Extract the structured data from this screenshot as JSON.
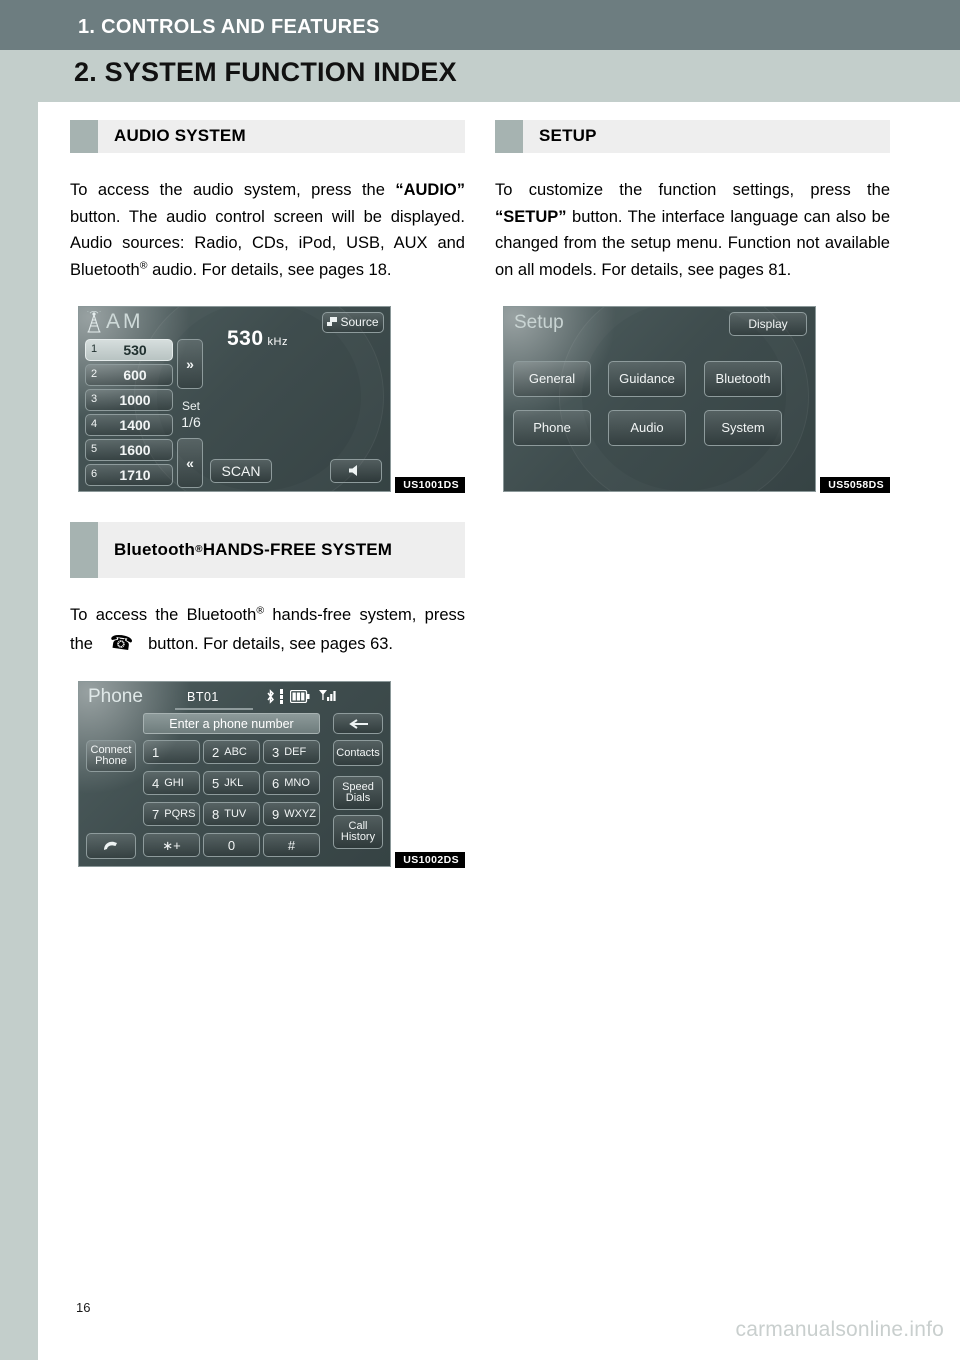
{
  "header": {
    "chapter": "1. CONTROLS AND FEATURES",
    "title": "2. SYSTEM FUNCTION INDEX"
  },
  "colors": {
    "band_dark": "#6d7d80",
    "band_light": "#c3cecb",
    "section_marker": "#a6b3b1",
    "section_bg": "#eeeeee",
    "screen_bg": "#445253"
  },
  "sections": {
    "audio": {
      "heading": "AUDIO SYSTEM",
      "body_part1": "To access the audio system, press the ",
      "body_bold1": "“AUDIO”",
      "body_part2": " button. The audio control screen will be displayed. Audio sources: Radio, CDs, iPod, USB, AUX and Bluetooth",
      "body_sup": "®",
      "body_part3": " audio. For details, see pages 18."
    },
    "bluetooth": {
      "heading_text": "Bluetooth",
      "heading_sup": "®",
      "heading_rest": " HANDS-FREE SYSTEM",
      "body_part1": "To access the Bluetooth",
      "body_sup": "®",
      "body_part2": " hands-free system, press the ",
      "body_icon": "phone-handset-icon",
      "body_part3": " button. For details, see pages 63."
    },
    "setup": {
      "heading": "SETUP",
      "body_part1": "To customize the function settings, press the ",
      "body_bold1": "“SETUP”",
      "body_part2": " button. The interface language can also be changed from the setup menu. Function not available on all models. For details, see pages 81."
    }
  },
  "screens": {
    "radio": {
      "code": "US1001DS",
      "band": "AM",
      "frequency": "530",
      "frequency_unit": "kHz",
      "source_label": "Source",
      "scan_label": "SCAN",
      "set_label": "Set",
      "page_label": "1/6",
      "next_label": "»",
      "prev_label": "«",
      "presets": [
        {
          "no": "1",
          "freq": "530",
          "selected": true
        },
        {
          "no": "2",
          "freq": "600",
          "selected": false
        },
        {
          "no": "3",
          "freq": "1000",
          "selected": false
        },
        {
          "no": "4",
          "freq": "1400",
          "selected": false
        },
        {
          "no": "5",
          "freq": "1600",
          "selected": false
        },
        {
          "no": "6",
          "freq": "1710",
          "selected": false
        }
      ]
    },
    "phone": {
      "code": "US1002DS",
      "title": "Phone",
      "device_name": "BT01",
      "entry_placeholder": "Enter a phone number",
      "connect_label_l1": "Connect",
      "connect_label_l2": "Phone",
      "contacts_label": "Contacts",
      "speed_dials_l1": "Speed",
      "speed_dials_l2": "Dials",
      "call_history_l1": "Call",
      "call_history_l2": "History",
      "keys": [
        {
          "num": "1",
          "alpha": ""
        },
        {
          "num": "2",
          "alpha": "ABC"
        },
        {
          "num": "3",
          "alpha": "DEF"
        },
        {
          "num": "4",
          "alpha": "GHI"
        },
        {
          "num": "5",
          "alpha": "JKL"
        },
        {
          "num": "6",
          "alpha": "MNO"
        },
        {
          "num": "7",
          "alpha": "PQRS"
        },
        {
          "num": "8",
          "alpha": "TUV"
        },
        {
          "num": "9",
          "alpha": "WXYZ"
        },
        {
          "num": "∗+",
          "alpha": ""
        },
        {
          "num": "0",
          "alpha": ""
        },
        {
          "num": "#",
          "alpha": ""
        }
      ]
    },
    "setup": {
      "code": "US5058DS",
      "title": "Setup",
      "display_label": "Display",
      "buttons": [
        "General",
        "Guidance",
        "Bluetooth",
        "Phone",
        "Audio",
        "System"
      ]
    }
  },
  "footer": {
    "page_number": "16",
    "watermark": "carmanualsonline.info"
  }
}
